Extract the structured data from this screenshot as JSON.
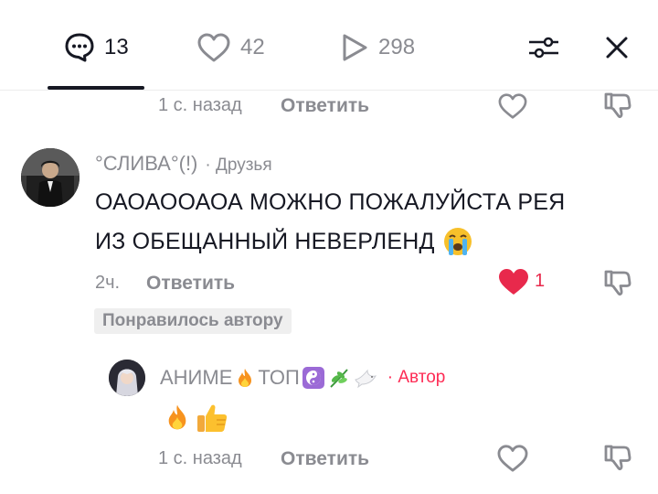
{
  "tabs": {
    "comments": {
      "count": "13"
    },
    "likes": {
      "count": "42"
    },
    "views": {
      "count": "298"
    }
  },
  "comments": [
    {
      "time": "1 с. назад",
      "reply_label": "Ответить"
    },
    {
      "author": "°СЛИВА°(!)",
      "relation": "· Друзья",
      "text_line1": "ОАОАООАОА МОЖНО ПОЖАЛУЙСТА РЕЯ",
      "text_line2": "ИЗ ОБЕЩАННЫЙ НЕВЕРЛЕНД",
      "time": "2ч.",
      "reply_label": "Ответить",
      "like_count": "1",
      "badge": "Понравилось автору"
    },
    {
      "author_text1": "АНИМЕ",
      "author_text2": "ТОП",
      "author_tag": "· Автор",
      "time": "1 с. назад",
      "reply_label": "Ответить"
    }
  ],
  "colors": {
    "text": "#161823",
    "muted": "#8a8b91",
    "like_red": "#fe2c55",
    "author_tag": "#fe2c55"
  }
}
